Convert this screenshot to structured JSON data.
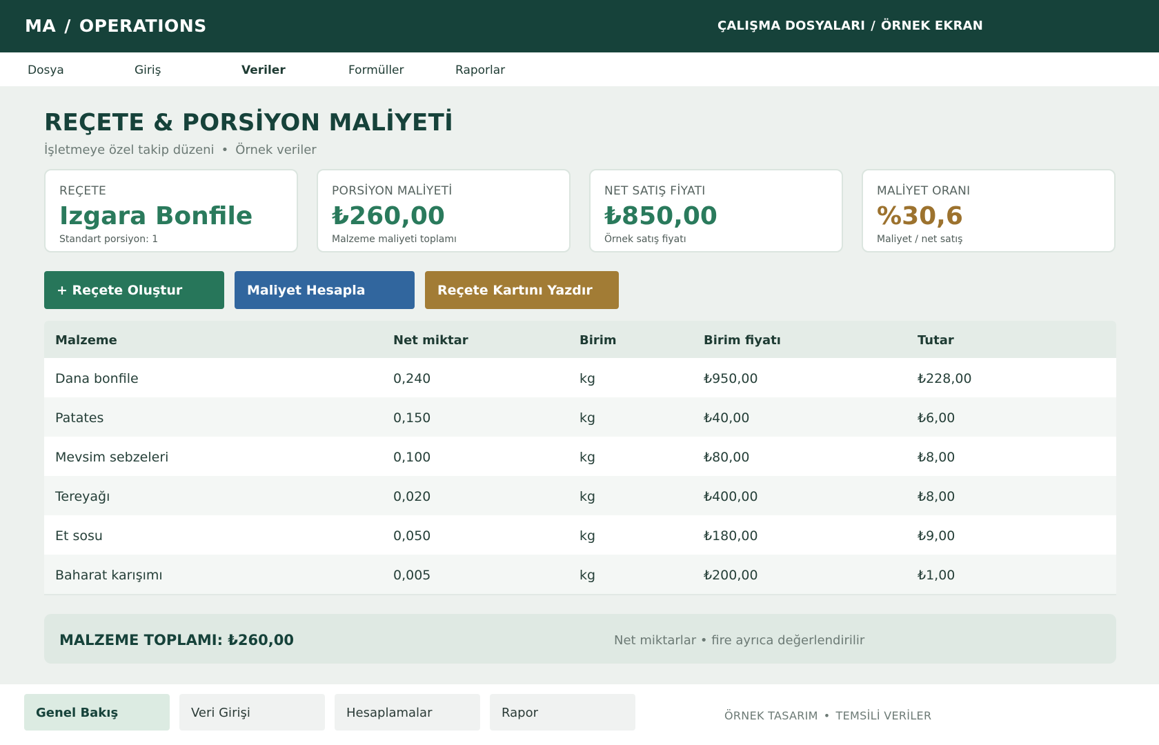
{
  "header": {
    "brand": "MA",
    "brand_separator": "/",
    "section": "OPERATIONS",
    "breadcrumb": [
      "ÇALIŞMA DOSYALARI",
      "ÖRNEK EKRAN"
    ],
    "breadcrumb_separator": "/"
  },
  "menu": {
    "items": [
      {
        "label": "Dosya"
      },
      {
        "label": "Giriş"
      },
      {
        "label": "Veriler",
        "active": true
      },
      {
        "label": "Formüller"
      },
      {
        "label": "Raporlar"
      }
    ]
  },
  "page": {
    "title": "REÇETE & PORSİYON MALİYETİ",
    "subtitle_left": "İşletmeye özel takip düzeni",
    "subtitle_dot": "•",
    "subtitle_right": "Örnek veriler"
  },
  "kpis": [
    {
      "label": "REÇETE",
      "value": "Izgara Bonfile",
      "note": "Standart porsiyon: 1"
    },
    {
      "label": "PORSİYON MALİYETİ",
      "value": "₺260,00",
      "note": "Malzeme maliyeti toplamı"
    },
    {
      "label": "NET SATIŞ FİYATI",
      "value": "₺850,00",
      "note": "Örnek satış fiyatı"
    },
    {
      "label": "MALİYET ORANI",
      "value": "%30,6",
      "note": "Maliyet / net satış"
    }
  ],
  "actions": {
    "create": "+ Reçete Oluştur",
    "calculate": "Maliyet Hesapla",
    "print": "Reçete Kartını Yazdır"
  },
  "table": {
    "columns": [
      "Malzeme",
      "Net miktar",
      "Birim",
      "Birim fiyatı",
      "Tutar"
    ],
    "rows": [
      [
        "Dana bonfile",
        "0,240",
        "kg",
        "₺950,00",
        "₺228,00"
      ],
      [
        "Patates",
        "0,150",
        "kg",
        "₺40,00",
        "₺6,00"
      ],
      [
        "Mevsim sebzeleri",
        "0,100",
        "kg",
        "₺80,00",
        "₺8,00"
      ],
      [
        "Tereyağı",
        "0,020",
        "kg",
        "₺400,00",
        "₺8,00"
      ],
      [
        "Et sosu",
        "0,050",
        "kg",
        "₺180,00",
        "₺9,00"
      ],
      [
        "Baharat karışımı",
        "0,005",
        "kg",
        "₺200,00",
        "₺1,00"
      ]
    ]
  },
  "total": {
    "label": "MALZEME TOPLAMI: ₺260,00",
    "note": "Net miktarlar • fire ayrıca değerlendirilir"
  },
  "footer": {
    "tabs": [
      {
        "label": "Genel Bakış",
        "active": true
      },
      {
        "label": "Veri Girişi"
      },
      {
        "label": "Hesaplamalar"
      },
      {
        "label": "Rapor"
      }
    ],
    "note_left": "ÖRNEK TASARIM",
    "note_dot": "•",
    "note_right": "TEMSİLİ VERİLER"
  },
  "colors": {
    "header_bg": "#16423a",
    "accent_green": "#27765a",
    "accent_blue": "#31669e",
    "accent_gold": "#a27c35",
    "kpi_value_green": "#2a7a5c",
    "kpi_value_gold": "#9c722e"
  }
}
